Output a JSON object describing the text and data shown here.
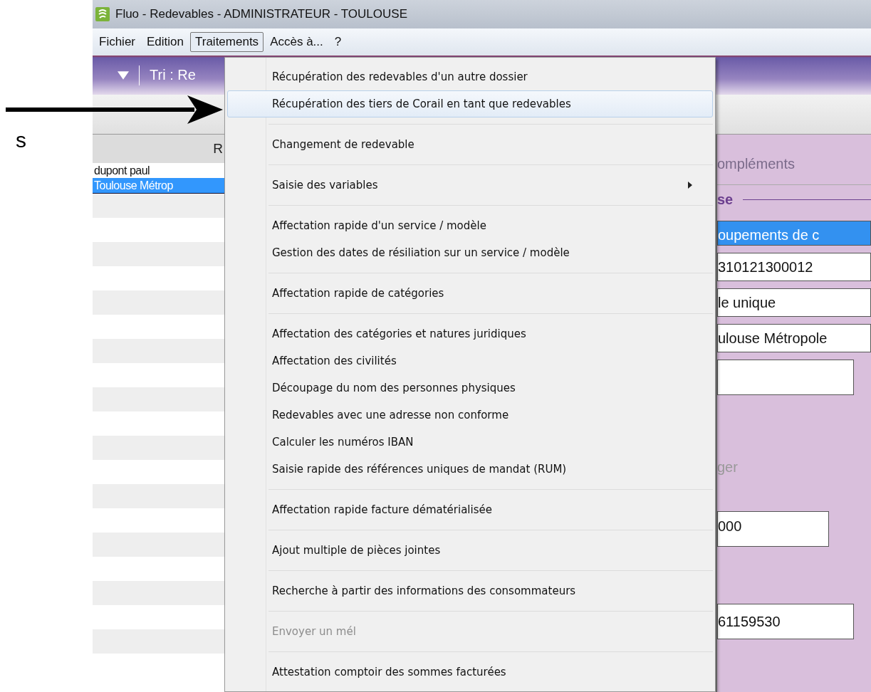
{
  "side_text": "s",
  "window": {
    "title": "Fluo - Redevables - ADMINISTRATEUR - TOULOUSE"
  },
  "menubar": [
    {
      "label": "Fichier",
      "selected": false
    },
    {
      "label": "Edition",
      "selected": false
    },
    {
      "label": "Traitements",
      "selected": true
    },
    {
      "label": "Accès à...",
      "selected": false
    },
    {
      "label": "?",
      "selected": false
    }
  ],
  "toolbar": {
    "sort_label": "Tri : Re"
  },
  "list": {
    "column_1": "R",
    "rows": [
      {
        "name": "dupont paul",
        "selected": false
      },
      {
        "name": "Toulouse Métrop",
        "selected": true
      }
    ]
  },
  "menu": [
    [
      {
        "label": "Récupération des redevables d'un autre dossier",
        "selected": false,
        "disabled": false,
        "submenu": false
      },
      {
        "label": "Récupération des tiers de Corail en tant que redevables",
        "selected": true,
        "disabled": false,
        "submenu": false
      }
    ],
    [
      {
        "label": "Changement de redevable",
        "selected": false,
        "disabled": false,
        "submenu": false
      }
    ],
    [
      {
        "label": "Saisie des variables",
        "selected": false,
        "disabled": false,
        "submenu": true
      }
    ],
    [
      {
        "label": "Affectation rapide d'un service / modèle",
        "selected": false,
        "disabled": false,
        "submenu": false
      },
      {
        "label": "Gestion des dates de résiliation sur un service / modèle",
        "selected": false,
        "disabled": false,
        "submenu": false
      }
    ],
    [
      {
        "label": "Affectation rapide de catégories",
        "selected": false,
        "disabled": false,
        "submenu": false
      }
    ],
    [
      {
        "label": "Affectation des catégories et natures juridiques",
        "selected": false,
        "disabled": false,
        "submenu": false
      },
      {
        "label": "Affectation des civilités",
        "selected": false,
        "disabled": false,
        "submenu": false
      },
      {
        "label": "Découpage du nom des personnes physiques",
        "selected": false,
        "disabled": false,
        "submenu": false
      },
      {
        "label": "Redevables avec une adresse non conforme",
        "selected": false,
        "disabled": false,
        "submenu": false
      },
      {
        "label": "Calculer les numéros IBAN",
        "selected": false,
        "disabled": false,
        "submenu": false
      },
      {
        "label": "Saisie rapide des références uniques de mandat (RUM)",
        "selected": false,
        "disabled": false,
        "submenu": false
      }
    ],
    [
      {
        "label": "Affectation rapide facture dématérialisée",
        "selected": false,
        "disabled": false,
        "submenu": false
      }
    ],
    [
      {
        "label": "Ajout multiple de pièces jointes",
        "selected": false,
        "disabled": false,
        "submenu": false
      }
    ],
    [
      {
        "label": "Recherche à partir des informations des consommateurs",
        "selected": false,
        "disabled": false,
        "submenu": false
      }
    ],
    [
      {
        "label": "Envoyer un mél",
        "selected": false,
        "disabled": true,
        "submenu": false
      }
    ],
    [
      {
        "label": "Attestation comptoir des sommes facturées",
        "selected": false,
        "disabled": false,
        "submenu": false
      }
    ]
  ],
  "panel": {
    "tab": "ompléments",
    "section": "se",
    "fields": [
      {
        "kind": "select",
        "value": "oupements de c"
      },
      {
        "kind": "field",
        "value": "310121300012"
      },
      {
        "kind": "field",
        "value": "le unique"
      },
      {
        "kind": "field",
        "value": "ulouse Métropole"
      },
      {
        "kind": "short"
      },
      {
        "kind": "label",
        "value": "ger"
      },
      {
        "kind": "mid",
        "value": "000"
      },
      {
        "kind": "gap"
      },
      {
        "kind": "short",
        "value": "61159530"
      }
    ]
  }
}
